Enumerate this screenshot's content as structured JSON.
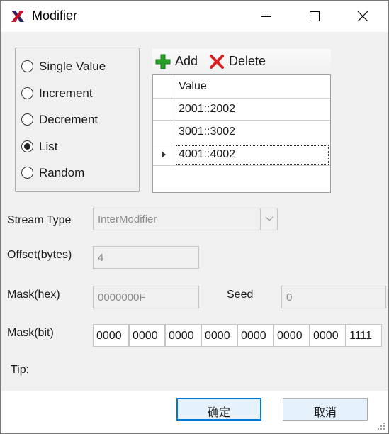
{
  "window": {
    "title": "Modifier",
    "app_icon": "red-x-icon",
    "minimize_icon": "minimize-icon",
    "maximize_icon": "maximize-icon",
    "close_icon": "close-icon"
  },
  "mode_options": [
    {
      "label": "Single Value",
      "checked": false
    },
    {
      "label": "Increment",
      "checked": false
    },
    {
      "label": "Decrement",
      "checked": false
    },
    {
      "label": "List",
      "checked": true
    },
    {
      "label": "Random",
      "checked": false
    }
  ],
  "toolbar": {
    "add_label": "Add",
    "delete_label": "Delete",
    "add_icon": "plus-icon",
    "delete_icon": "delete-x-icon"
  },
  "grid": {
    "column_header": "Value",
    "rows": [
      "2001::2002",
      "3001::3002",
      "4001::4002"
    ],
    "current_row": 2
  },
  "form": {
    "stream_type_label": "Stream Type",
    "stream_type_value": "InterModifier",
    "offset_label": "Offset(bytes)",
    "offset_value": "4",
    "mask_hex_label": "Mask(hex)",
    "mask_hex_value": "0000000F",
    "seed_label": "Seed",
    "seed_value": "0",
    "mask_bit_label": "Mask(bit)",
    "mask_bits": [
      "0000",
      "0000",
      "0000",
      "0000",
      "0000",
      "0000",
      "0000",
      "1111"
    ],
    "tip_label": "Tip:"
  },
  "buttons": {
    "ok_label": "确定",
    "cancel_label": "取消"
  },
  "colors": {
    "accent": "#0078d7",
    "add_green": "#2aa12a",
    "delete_red": "#d42020",
    "app_icon_red": "#c8102e",
    "app_icon_navy": "#1f2a60"
  }
}
